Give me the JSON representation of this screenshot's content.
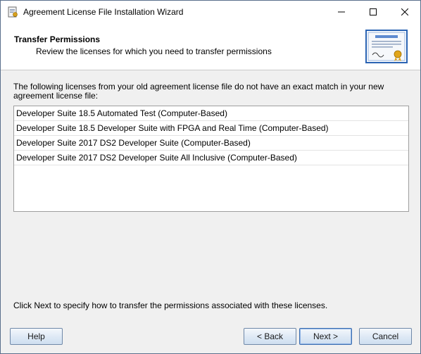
{
  "window": {
    "title": "Agreement License File Installation Wizard",
    "bleed_text": "……… ……… … ……… …"
  },
  "header": {
    "title": "Transfer Permissions",
    "subtitle": "Review the licenses for which you need to transfer permissions"
  },
  "intro": "The following licenses from your old agreement license file do not have an exact match in your new agreement license file:",
  "licenses": [
    "Developer Suite 18.5 Automated Test (Computer-Based)",
    "Developer Suite 18.5 Developer Suite with FPGA and Real Time (Computer-Based)",
    "Developer Suite 2017 DS2 Developer Suite (Computer-Based)",
    "Developer Suite 2017 DS2 Developer Suite All Inclusive (Computer-Based)"
  ],
  "footer": "Click Next to specify how to transfer the permissions associated with these licenses.",
  "buttons": {
    "help": "Help",
    "back": "< Back",
    "next": "Next >",
    "cancel": "Cancel"
  },
  "colors": {
    "accent": "#3d6fb0",
    "button_border": "#6f88a8",
    "window_bg": "#f0f0f0"
  }
}
